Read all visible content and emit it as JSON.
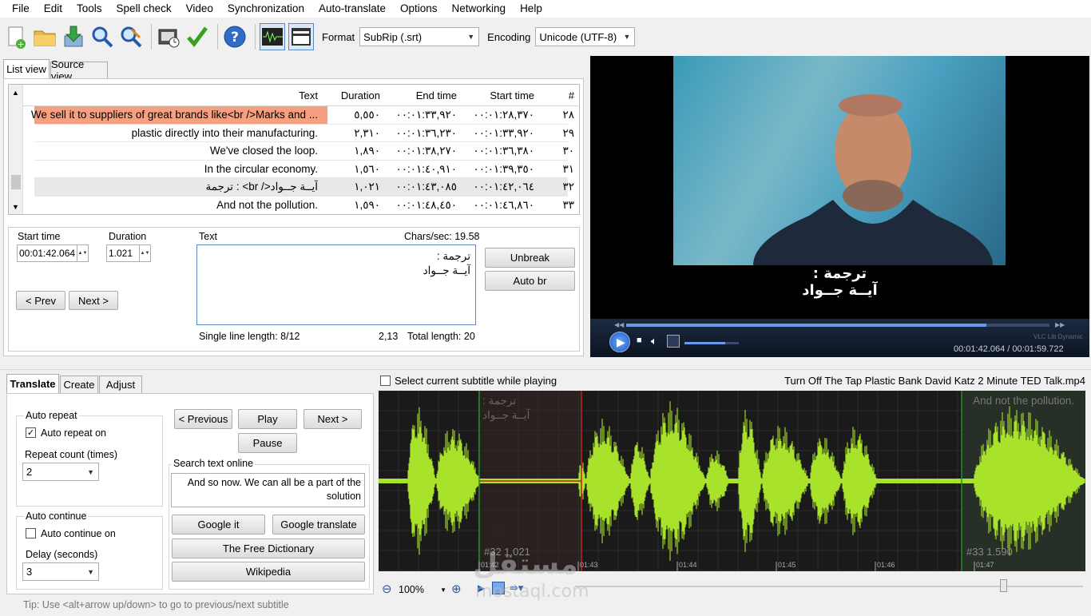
{
  "menu": [
    "File",
    "Edit",
    "Tools",
    "Spell check",
    "Video",
    "Synchronization",
    "Auto-translate",
    "Options",
    "Networking",
    "Help"
  ],
  "toolbar": {
    "format_label": "Format",
    "format_value": "SubRip (.srt)",
    "encoding_label": "Encoding",
    "encoding_value": "Unicode (UTF-8)",
    "icons": [
      "new-file-icon",
      "open-folder-icon",
      "download-icon",
      "find-icon",
      "replace-icon",
      "visual-sync-icon",
      "spellcheck-icon",
      "help-icon",
      "waveform-icon",
      "video-icon"
    ]
  },
  "view_tabs": {
    "list": "List view",
    "source": "Source view"
  },
  "grid": {
    "headers": {
      "number": "#",
      "start": "Start time",
      "end": "End time",
      "duration": "Duration",
      "text": "Text"
    },
    "rows": [
      {
        "number": "٢٨",
        "start": "٠٠:٠١:٢٨,٣٧٠",
        "end": "٠٠:٠١:٣٣,٩٢٠",
        "duration": "٥,٥٥٠",
        "text": "We sell it to suppliers of great brands like<br />Marks and ..."
      },
      {
        "number": "٢٩",
        "start": "٠٠:٠١:٣٣,٩٢٠",
        "end": "٠٠:٠١:٣٦,٢٣٠",
        "duration": "٢,٣١٠",
        "text": "plastic directly into their manufacturing."
      },
      {
        "number": "٣٠",
        "start": "٠٠:٠١:٣٦,٣٨٠",
        "end": "٠٠:٠١:٣٨,٢٧٠",
        "duration": "١,٨٩٠",
        "text": "We've closed the loop."
      },
      {
        "number": "٣١",
        "start": "٠٠:٠١:٣٩,٣٥٠",
        "end": "٠٠:٠١:٤٠,٩١٠",
        "duration": "١,٥٦٠",
        "text": "In the circular economy."
      },
      {
        "number": "٣٢",
        "start": "٠٠:٠١:٤٢,٠٦٤",
        "end": "٠٠:٠١:٤٣,٠٨٥",
        "duration": "١,٠٢١",
        "text": "ترجمة : <br />آيــة جــواد"
      },
      {
        "number": "٣٣",
        "start": "٠٠:٠١:٤٦,٨٦٠",
        "end": "٠٠:٠١:٤٨,٤٥٠",
        "duration": "١,٥٩٠",
        "text": "And not the pollution."
      }
    ]
  },
  "editor": {
    "start_time_label": "Start time",
    "start_time_value": "00:01:42.064",
    "duration_label": "Duration",
    "duration_value": "1.021",
    "text_label": "Text",
    "chars_sec": "Chars/sec: 19.58",
    "text_line1": "ترجمة :",
    "text_line2": "آيــة جــواد",
    "prev_label": "< Prev",
    "next_label": "Next >",
    "unbreak_label": "Unbreak",
    "autobr_label": "Auto br",
    "single_line_length": "Single line length: 8/12",
    "position": "2,13",
    "total_length": "Total length: 20"
  },
  "video": {
    "subtitle_line1": "ترجمة :",
    "subtitle_line2": "آيــة جــواد",
    "brand": "VLC Lib Dynamic",
    "time": "00:01:42.064 / 00:01:59.722",
    "progress": 0.85,
    "volume": 0.75
  },
  "bottom_tabs": {
    "translate": "Translate",
    "create": "Create",
    "adjust": "Adjust"
  },
  "translate": {
    "auto_repeat_title": "Auto repeat",
    "auto_repeat_on": "Auto repeat on",
    "repeat_count_label": "Repeat count (times)",
    "repeat_count_value": "2",
    "auto_continue_title": "Auto continue",
    "auto_continue_on": "Auto continue on",
    "delay_label": "Delay (seconds)",
    "delay_value": "3",
    "previous": "< Previous",
    "play": "Play",
    "next": "Next >",
    "pause": "Pause",
    "search_title": "Search text online",
    "search_text_1": "And so now. We can all be a part of the",
    "search_text_2": "solution",
    "google_it": "Google it",
    "google_translate": "Google translate",
    "free_dictionary": "The Free Dictionary",
    "wikipedia": "Wikipedia",
    "tip": "Tip: Use <alt+arrow up/down> to go to previous/next subtitle"
  },
  "waveform": {
    "select_current_label": "Select current subtitle while playing",
    "filename": "Turn Off The Tap Plastic Bank David Katz 2 Minute TED Talk.mp4",
    "overlay_sub1_line1": "ترجمة :",
    "overlay_sub1_line2": "آيــة جــواد",
    "overlay_sub2": "And not the pollution.",
    "marker1": "#32  1.021",
    "marker2": "#33  1.590",
    "ticks": [
      "01:42",
      "01:43",
      "01:44",
      "01:45",
      "01:46",
      "01:47"
    ],
    "zoom": "100%",
    "colors": {
      "wave": "#a8e22a",
      "selection": "#c02020",
      "background": "#1a1a1a"
    }
  },
  "watermark": {
    "arabic": "مستقل",
    "latin": "mostaql.com"
  }
}
